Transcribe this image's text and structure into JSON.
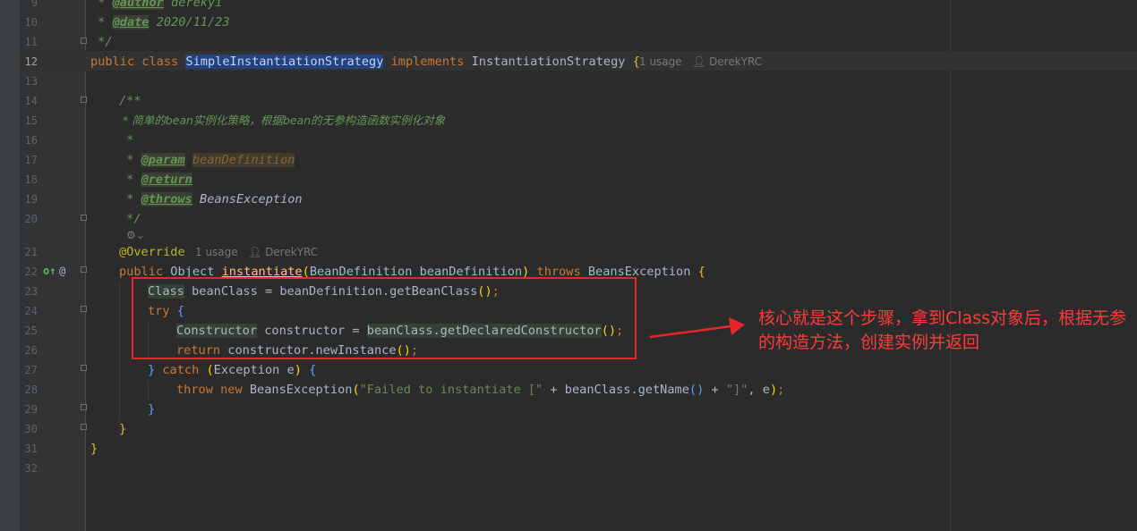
{
  "lines": [
    {
      "num": "9"
    },
    {
      "num": "10"
    },
    {
      "num": "11"
    },
    {
      "num": "12"
    },
    {
      "num": "13"
    },
    {
      "num": "14"
    },
    {
      "num": "15"
    },
    {
      "num": "16"
    },
    {
      "num": "17"
    },
    {
      "num": "18"
    },
    {
      "num": "19"
    },
    {
      "num": "20"
    },
    {
      "num": "21"
    },
    {
      "num": "22"
    },
    {
      "num": "23"
    },
    {
      "num": "24"
    },
    {
      "num": "25"
    },
    {
      "num": "26"
    },
    {
      "num": "27"
    },
    {
      "num": "28"
    },
    {
      "num": "29"
    },
    {
      "num": "30"
    },
    {
      "num": "31"
    },
    {
      "num": "32"
    }
  ],
  "code": {
    "l9_author_tag": "@author",
    "l9_author_val": " derekyi",
    "l10_date_tag": "@date",
    "l10_date_val": " 2020/11/23",
    "l11": " */",
    "l12_public": "public",
    "l12_class": "class",
    "l12_name": "SimpleInstantiationStrategy",
    "l12_implements": "implements",
    "l12_iface": "InstantiationStrategy",
    "l14": "/**",
    "l15": " * 简单的bean实例化策略，根据bean的无参构造函数实例化对象",
    "l16": " *",
    "l17_tag": "@param",
    "l17_param": "beanDefinition",
    "l18_tag": "@return",
    "l19_tag": "@throws",
    "l19_val": " BeansException",
    "l20": " */",
    "l21_ann": "@Override",
    "l22_public": "public",
    "l22_type": "Object",
    "l22_method": "instantiate",
    "l22_args": "BeanDefinition beanDefinition",
    "l22_throws": "throws",
    "l22_exc": "BeansException",
    "l23_type": "Class",
    "l23_rest": " beanClass = beanDefinition.getBeanClass",
    "l24_try": "try",
    "l25_type": "Constructor",
    "l25_rest": " constructor = ",
    "l25_call": "beanClass.getDeclaredConstructor",
    "l26_return": "return",
    "l26_rest": " constructor.newInstance",
    "l27_catch": "catch",
    "l27_rest": "Exception e",
    "l28_throw": "throw",
    "l28_new": "new",
    "l28_ctor": " BeansException",
    "l28_str1": "\"Failed to instantiate [\"",
    "l28_mid": " + beanClass.getName",
    "l28_str2": "\"]\"",
    "l28_end": ", e"
  },
  "hints": {
    "class_usage": "1 usage",
    "class_author": "DerekYRC",
    "method_usage": "1 usage",
    "method_author": "DerekYRC"
  },
  "annotation": {
    "text": "核心就是这个步骤，拿到Class对象后，根据无参的构造方法，创建实例并返回",
    "color": "#ff3a3a"
  }
}
